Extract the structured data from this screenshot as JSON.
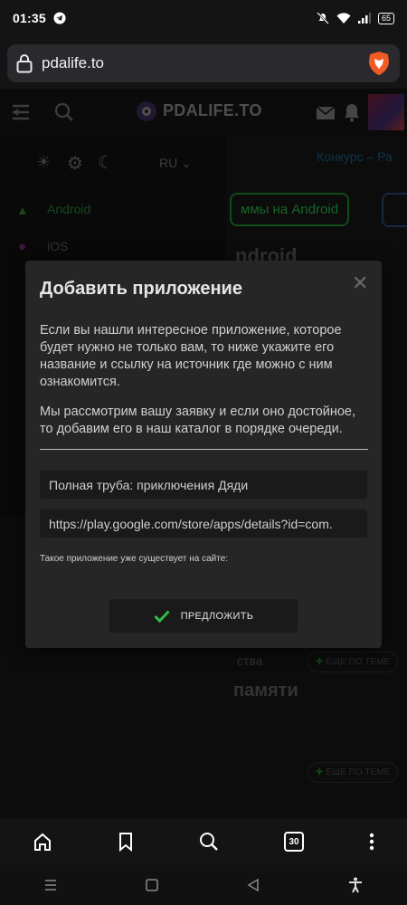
{
  "status_bar": {
    "time": "01:35",
    "battery": "65"
  },
  "browser": {
    "url": "pdalife.to",
    "tab_count": "30"
  },
  "site": {
    "logo": "PDALIFE.TO",
    "lang": "RU",
    "contest_link": "Конкурс – Ра",
    "sidebar": [
      "Android",
      "iOS"
    ],
    "button_android": "ммы на Android",
    "heading_android": "ndroid",
    "more_label": "ЕЩЕ ПО ТЕМЕ",
    "text_fragment": "ства",
    "heading_memory": "памяти"
  },
  "modal": {
    "title": "Добавить приложение",
    "paragraph1": "Если вы нашли интересное приложение, которое будет нужно не только вам, то ниже укажите его название и ссылку на источник где можно с ним ознакомится.",
    "paragraph2": "Мы рассмотрим вашу заявку и если оно достойное, то добавим его в наш каталог в порядке очереди.",
    "name_value": "Полная труба: приключения Дяди",
    "link_value": "https://play.google.com/store/apps/details?id=com.",
    "note": "Такое приложение уже существует на сайте:",
    "submit_label": "ПРЕДЛОЖИТЬ"
  }
}
